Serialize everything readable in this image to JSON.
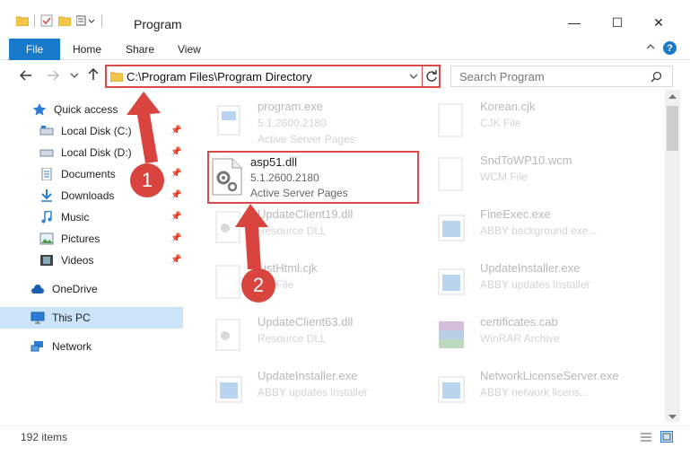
{
  "window": {
    "title": "Program",
    "minimize": "—",
    "maximize": "☐",
    "close": "✕"
  },
  "ribbon": {
    "tabs": [
      {
        "label": "File"
      },
      {
        "label": "Home"
      },
      {
        "label": "Share"
      },
      {
        "label": "View"
      }
    ],
    "help_label": "?"
  },
  "address": {
    "path": "C:\\Program Files\\Program Directory",
    "search_placeholder": "Search Program"
  },
  "sidebar": {
    "items": [
      {
        "label": "Quick access"
      },
      {
        "label": "Local Disk (C:)"
      },
      {
        "label": "Local Disk (D:)"
      },
      {
        "label": "Documents"
      },
      {
        "label": "Downloads"
      },
      {
        "label": "Music"
      },
      {
        "label": "Pictures"
      },
      {
        "label": "Videos"
      },
      {
        "label": "OneDrive"
      },
      {
        "label": "This PC"
      },
      {
        "label": "Network"
      }
    ]
  },
  "files": {
    "left": [
      {
        "name": "program.exe",
        "line2": "5.1.2600.2180",
        "line3": "Active Server Pages"
      },
      {
        "name": "asp51.dll",
        "line2": "5.1.2600.2180",
        "line3": "Active Server Pages"
      },
      {
        "name": "UpdateClient19.dll",
        "line2": "Resource DLL"
      },
      {
        "name": "ListHtml.cjk",
        "line2": "Cjk File"
      },
      {
        "name": "UpdateClient63.dll",
        "line2": "Resource DLL"
      },
      {
        "name": "UpdateInstaller.exe",
        "line2": "ABBY updates installer"
      }
    ],
    "right": [
      {
        "name": "Korean.cjk",
        "line2": "CJK File"
      },
      {
        "name": "SndToWP10.wcm",
        "line2": "WCM File"
      },
      {
        "name": "FineExec.exe",
        "line2": "ABBY background exe..."
      },
      {
        "name": "UpdateInstaller.exe",
        "line2": "ABBY updates installer"
      },
      {
        "name": "certificates.cab",
        "line2": "WinRAR Archive"
      },
      {
        "name": "NetworkLicenseServer.exe",
        "line2": "ABBY network licens..."
      }
    ]
  },
  "status": {
    "count": "192 items"
  },
  "callouts": {
    "one": "1",
    "two": "2"
  },
  "colors": {
    "accent": "#1979ca",
    "highlight": "#d94a4a",
    "selected": "#cce4f7"
  }
}
